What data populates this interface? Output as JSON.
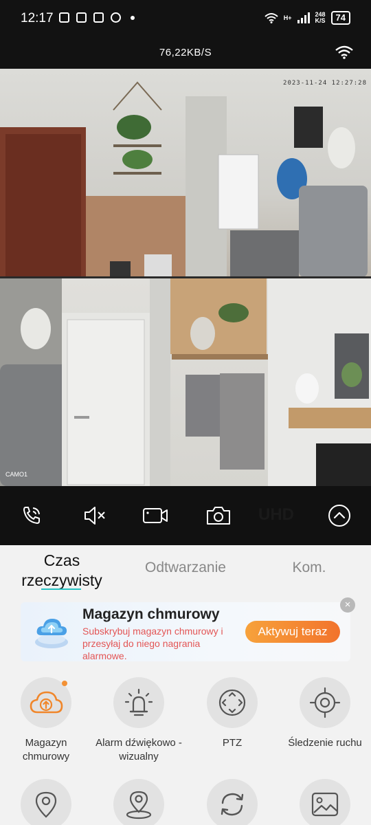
{
  "status_bar": {
    "time": "12:17",
    "network_speed": "248",
    "network_unit": "K/S",
    "network_type": "H+",
    "battery": "74"
  },
  "stream": {
    "speed": "76,22KB/S"
  },
  "camera": {
    "timestamp": "2023-11-24 12:27:28",
    "label": "CAMO1"
  },
  "controls": {
    "quality_label": "UHD"
  },
  "tabs": [
    {
      "label": "Czas rzeczywisty",
      "active": true
    },
    {
      "label": "Odtwarzanie",
      "active": false
    },
    {
      "label": "Kom.",
      "active": false
    }
  ],
  "banner": {
    "title": "Magazyn chmurowy",
    "subtitle": "Subskrybuj magazyn chmurowy i przesyłaj do niego nagrania alarmowe.",
    "button": "Aktywuj teraz",
    "close": "×"
  },
  "features": [
    {
      "label": "Magazyn chmurowy",
      "icon": "cloud-upload-icon"
    },
    {
      "label": "Alarm dźwiękowo -wizualny",
      "icon": "alarm-light-icon"
    },
    {
      "label": "PTZ",
      "icon": "ptz-icon"
    },
    {
      "label": "Śledzenie ruchu",
      "icon": "crosshair-icon"
    }
  ],
  "colors": {
    "accent_teal": "#26c1c1",
    "orange": "#f39135",
    "banner_red": "#e35555"
  }
}
